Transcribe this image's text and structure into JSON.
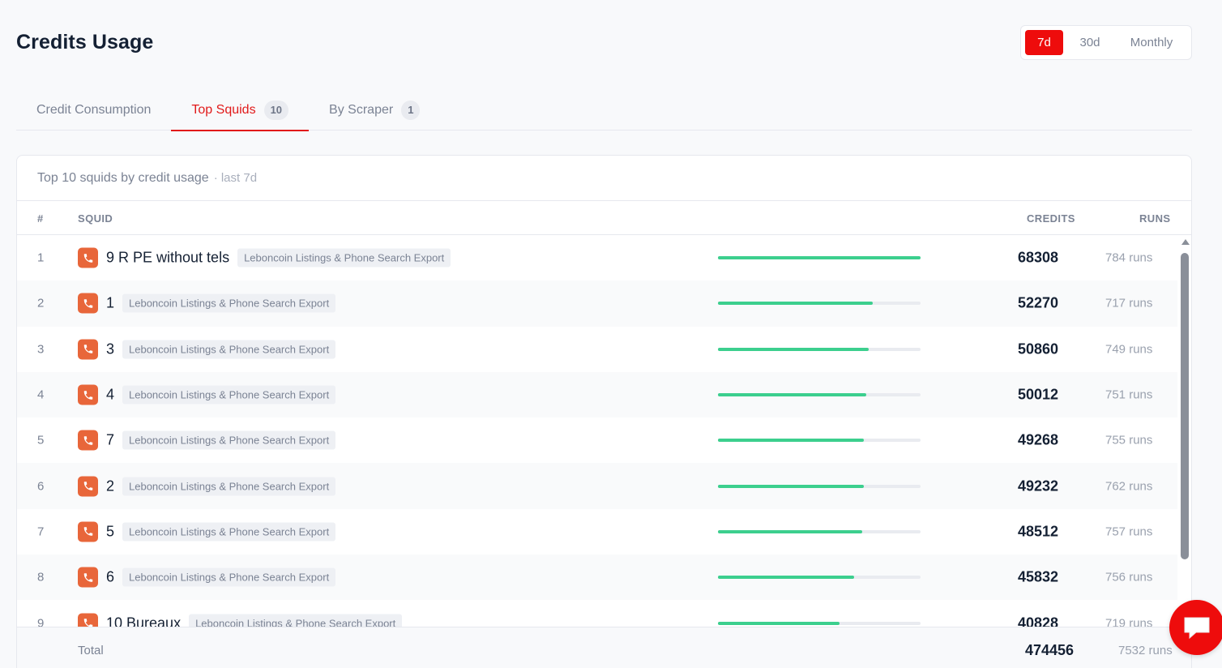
{
  "page": {
    "title": "Credits Usage"
  },
  "range": {
    "options": [
      {
        "label": "7d",
        "active": true
      },
      {
        "label": "30d",
        "active": false
      },
      {
        "label": "Monthly",
        "active": false
      }
    ]
  },
  "tabs": [
    {
      "label": "Credit Consumption",
      "count": null,
      "active": false
    },
    {
      "label": "Top Squids",
      "count": "10",
      "active": true
    },
    {
      "label": "By Scraper",
      "count": "1",
      "active": false
    }
  ],
  "card": {
    "title": "Top 10 squids by credit usage",
    "subtitle": "· last 7d",
    "columns": {
      "rank": "#",
      "squid": "SQUID",
      "credits": "CREDITS",
      "runs": "RUNS"
    }
  },
  "rows": [
    {
      "rank": "1",
      "name": "9 R PE without tels",
      "tag": "Leboncoin Listings & Phone Search Export",
      "share": 1.0,
      "credits": "68308",
      "runs": "784 runs"
    },
    {
      "rank": "2",
      "name": "1",
      "tag": "Leboncoin Listings & Phone Search Export",
      "share": 0.765,
      "credits": "52270",
      "runs": "717 runs"
    },
    {
      "rank": "3",
      "name": "3",
      "tag": "Leboncoin Listings & Phone Search Export",
      "share": 0.745,
      "credits": "50860",
      "runs": "749 runs"
    },
    {
      "rank": "4",
      "name": "4",
      "tag": "Leboncoin Listings & Phone Search Export",
      "share": 0.732,
      "credits": "50012",
      "runs": "751 runs"
    },
    {
      "rank": "5",
      "name": "7",
      "tag": "Leboncoin Listings & Phone Search Export",
      "share": 0.721,
      "credits": "49268",
      "runs": "755 runs"
    },
    {
      "rank": "6",
      "name": "2",
      "tag": "Leboncoin Listings & Phone Search Export",
      "share": 0.721,
      "credits": "49232",
      "runs": "762 runs"
    },
    {
      "rank": "7",
      "name": "5",
      "tag": "Leboncoin Listings & Phone Search Export",
      "share": 0.71,
      "credits": "48512",
      "runs": "757 runs"
    },
    {
      "rank": "8",
      "name": "6",
      "tag": "Leboncoin Listings & Phone Search Export",
      "share": 0.671,
      "credits": "45832",
      "runs": "756 runs"
    },
    {
      "rank": "9",
      "name": "10 Bureaux",
      "tag": "Leboncoin Listings & Phone Search Export",
      "share": 0.598,
      "credits": "40828",
      "runs": "719 runs"
    }
  ],
  "total": {
    "label": "Total",
    "credits": "474456",
    "runs": "7532 runs"
  },
  "colors": {
    "accent": "#ee0c0c",
    "bar": "#3ccf8e",
    "squid_icon": "#e8663a"
  },
  "icons": {
    "row": "phone-icon",
    "chat": "chat-icon"
  }
}
